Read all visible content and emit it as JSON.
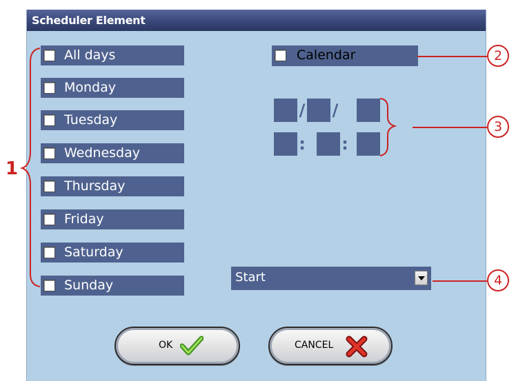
{
  "dialog": {
    "title": "Scheduler Element"
  },
  "days": [
    {
      "label": "All days"
    },
    {
      "label": "Monday"
    },
    {
      "label": "Tuesday"
    },
    {
      "label": "Wednesday"
    },
    {
      "label": "Thursday"
    },
    {
      "label": "Friday"
    },
    {
      "label": "Saturday"
    },
    {
      "label": "Sunday"
    }
  ],
  "calendar": {
    "label": "Calendar",
    "date_separator": "/",
    "time_separator": ":"
  },
  "mode_select": {
    "value": "Start"
  },
  "buttons": {
    "ok_label": "OK",
    "cancel_label": "CANCEL"
  },
  "annotations": {
    "a1": "1",
    "a2": "2",
    "a3": "3",
    "a4": "4"
  },
  "colors": {
    "field_bg": "#4f628f",
    "dialog_bg": "#b3d0e6",
    "annotation": "#cc2222"
  },
  "icons": {
    "ok": "checkmark-icon",
    "cancel": "x-icon",
    "dropdown": "chevron-down-icon"
  }
}
